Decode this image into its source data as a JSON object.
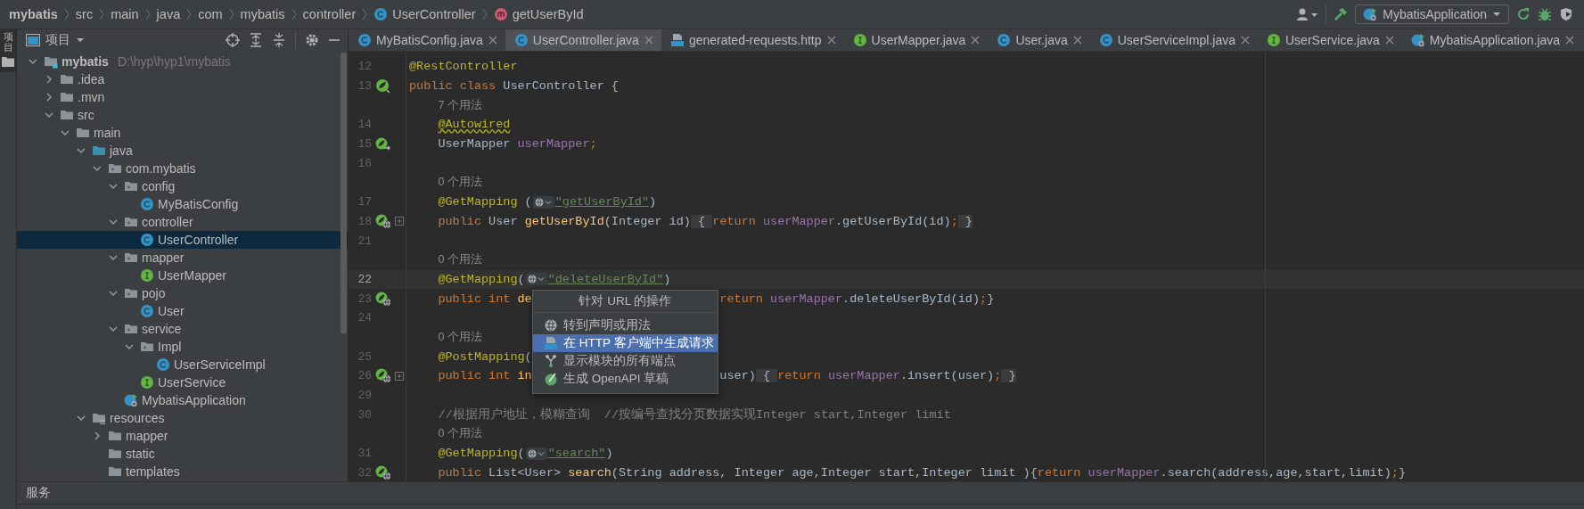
{
  "breadcrumb": [
    {
      "kind": "project",
      "label": "mybatis"
    },
    {
      "kind": "folder",
      "label": "src"
    },
    {
      "kind": "folder",
      "label": "main"
    },
    {
      "kind": "folder",
      "label": "java"
    },
    {
      "kind": "folder",
      "label": "com"
    },
    {
      "kind": "folder",
      "label": "mybatis"
    },
    {
      "kind": "folder",
      "label": "controller"
    },
    {
      "kind": "class",
      "label": "UserController"
    },
    {
      "kind": "method",
      "label": "getUserById"
    }
  ],
  "toolbar": {
    "run_config": "MybatisApplication"
  },
  "side_strip": {
    "label": "项目",
    "selected": true
  },
  "project_panel": {
    "title": "项目",
    "tree": [
      {
        "label": "mybatis",
        "kind": "module",
        "path": "D:\\hyp\\hyp1\\mybatis",
        "expanded": true,
        "selected": false,
        "children": [
          {
            "label": ".idea",
            "kind": "folder",
            "expanded": false,
            "selected": false
          },
          {
            "label": ".mvn",
            "kind": "folder",
            "expanded": false,
            "selected": false
          },
          {
            "label": "src",
            "kind": "folder",
            "expanded": true,
            "selected": false,
            "children": [
              {
                "label": "main",
                "kind": "folder",
                "expanded": true,
                "selected": false,
                "children": [
                  {
                    "label": "java",
                    "kind": "source",
                    "expanded": true,
                    "selected": false,
                    "children": [
                      {
                        "label": "com.mybatis",
                        "kind": "package",
                        "expanded": true,
                        "selected": false,
                        "children": [
                          {
                            "label": "config",
                            "kind": "package",
                            "expanded": true,
                            "selected": false,
                            "children": [
                              {
                                "label": "MyBatisConfig",
                                "kind": "class",
                                "selected": false
                              }
                            ]
                          },
                          {
                            "label": "controller",
                            "kind": "package",
                            "expanded": true,
                            "selected": false,
                            "children": [
                              {
                                "label": "UserController",
                                "kind": "class",
                                "selected": true
                              }
                            ]
                          },
                          {
                            "label": "mapper",
                            "kind": "package",
                            "expanded": true,
                            "selected": false,
                            "children": [
                              {
                                "label": "UserMapper",
                                "kind": "interface",
                                "selected": false
                              }
                            ]
                          },
                          {
                            "label": "pojo",
                            "kind": "package",
                            "expanded": true,
                            "selected": false,
                            "children": [
                              {
                                "label": "User",
                                "kind": "class",
                                "selected": false
                              }
                            ]
                          },
                          {
                            "label": "service",
                            "kind": "package",
                            "expanded": true,
                            "selected": false,
                            "children": [
                              {
                                "label": "Impl",
                                "kind": "package",
                                "expanded": true,
                                "selected": false,
                                "children": [
                                  {
                                    "label": "UserServiceImpl",
                                    "kind": "class",
                                    "selected": false
                                  }
                                ]
                              },
                              {
                                "label": "UserService",
                                "kind": "interface",
                                "selected": false
                              }
                            ]
                          },
                          {
                            "label": "MybatisApplication",
                            "kind": "app",
                            "selected": false
                          }
                        ]
                      }
                    ]
                  },
                  {
                    "label": "resources",
                    "kind": "resources",
                    "expanded": true,
                    "selected": false,
                    "children": [
                      {
                        "label": "mapper",
                        "kind": "folder",
                        "expanded": false,
                        "selected": false
                      },
                      {
                        "label": "static",
                        "kind": "folder",
                        "selected": false
                      },
                      {
                        "label": "templates",
                        "kind": "folder",
                        "selected": false
                      }
                    ]
                  }
                ]
              }
            ]
          }
        ]
      }
    ]
  },
  "tabs": [
    {
      "label": "MyBatisConfig.java",
      "kind": "class",
      "selected": false
    },
    {
      "label": "UserController.java",
      "kind": "class",
      "selected": true
    },
    {
      "label": "generated-requests.http",
      "kind": "api",
      "selected": false
    },
    {
      "label": "UserMapper.java",
      "kind": "interface",
      "selected": false
    },
    {
      "label": "User.java",
      "kind": "class",
      "selected": false
    },
    {
      "label": "UserServiceImpl.java",
      "kind": "class",
      "selected": false
    },
    {
      "label": "UserService.java",
      "kind": "interface",
      "selected": false
    },
    {
      "label": "MybatisApplication.java",
      "kind": "app",
      "selected": false
    }
  ],
  "editor": {
    "rows": [
      {
        "kind": "code",
        "num": "12",
        "current": false,
        "tokens": [
          {
            "kind": "ann",
            "text": "@RestController"
          }
        ]
      },
      {
        "kind": "code",
        "num": "13",
        "current": false,
        "gutter": {
          "kind": "bean"
        },
        "tokens": [
          {
            "kind": "kw",
            "text": "public class "
          },
          {
            "kind": "plain",
            "text": "UserController {"
          }
        ]
      },
      {
        "kind": "hint",
        "text": "7 个用法"
      },
      {
        "kind": "code",
        "num": "14",
        "current": false,
        "indented": true,
        "tokens": [
          {
            "kind": "warn",
            "text": "@Autowired"
          }
        ]
      },
      {
        "kind": "code",
        "num": "15",
        "current": false,
        "indented": true,
        "gutter": {
          "kind": "injection"
        },
        "tokens": [
          {
            "kind": "plain",
            "text": "UserMapper "
          },
          {
            "kind": "field",
            "text": "userMapper"
          },
          {
            "kind": "kw",
            "text": ";"
          }
        ]
      },
      {
        "kind": "code",
        "num": "16",
        "current": false,
        "tokens": []
      },
      {
        "kind": "hint",
        "text": "0 个用法"
      },
      {
        "kind": "code",
        "num": "17",
        "current": false,
        "indented": true,
        "tokens": [
          {
            "kind": "ann",
            "text": "@GetMapping "
          },
          {
            "kind": "plain",
            "text": "("
          },
          {
            "kind": "inlay"
          },
          {
            "kind": "link",
            "text": "\"getUserById\""
          },
          {
            "kind": "plain",
            "text": ")"
          }
        ]
      },
      {
        "kind": "code",
        "num": "18",
        "current": false,
        "indented": true,
        "gutter": {
          "kind": "endpoint"
        },
        "fold": true,
        "tokens": [
          {
            "kind": "kw",
            "text": "public "
          },
          {
            "kind": "plain",
            "text": "User "
          },
          {
            "kind": "method",
            "text": "getUserById"
          },
          {
            "kind": "plain",
            "text": "(Integer id)"
          },
          {
            "kind": "fold",
            "text": " { "
          },
          {
            "kind": "kw",
            "text": "return "
          },
          {
            "kind": "field",
            "text": "userMapper"
          },
          {
            "kind": "plain",
            "text": ".getUserById(id)"
          },
          {
            "kind": "kw",
            "text": ";"
          },
          {
            "kind": "fold",
            "text": " }"
          }
        ]
      },
      {
        "kind": "code",
        "num": "21",
        "current": false,
        "tokens": []
      },
      {
        "kind": "hint",
        "text": "0 个用法"
      },
      {
        "kind": "code",
        "num": "22",
        "current": true,
        "indented": true,
        "tokens": [
          {
            "kind": "ann",
            "text": "@GetMapping"
          },
          {
            "kind": "plain",
            "text": "("
          },
          {
            "kind": "inlay"
          },
          {
            "kind": "link",
            "text": "\"deleteUserById\""
          },
          {
            "kind": "plain",
            "text": ")"
          }
        ]
      },
      {
        "kind": "code",
        "num": "23",
        "current": false,
        "indented": true,
        "gutter": {
          "kind": "endpoint"
        },
        "tokens": [
          {
            "kind": "kw",
            "text": "public int "
          },
          {
            "kind": "method",
            "text": "de"
          },
          {
            "kind": "covered"
          },
          {
            "kind": "kw",
            "text": "return "
          },
          {
            "kind": "field",
            "text": "userMapper"
          },
          {
            "kind": "plain",
            "text": ".deleteUserById(id)"
          },
          {
            "kind": "kw",
            "text": ";"
          },
          {
            "kind": "plain",
            "text": "}"
          }
        ]
      },
      {
        "kind": "code",
        "num": "24",
        "current": false,
        "tokens": []
      },
      {
        "kind": "hint",
        "text": "0 个用法"
      },
      {
        "kind": "code",
        "num": "25",
        "current": false,
        "indented": true,
        "tokens": [
          {
            "kind": "ann",
            "text": "@PostMapping"
          },
          {
            "kind": "plain",
            "text": "("
          }
        ]
      },
      {
        "kind": "code",
        "num": "26",
        "current": false,
        "indented": true,
        "gutter": {
          "kind": "endpoint"
        },
        "fold": true,
        "tokens": [
          {
            "kind": "kw",
            "text": "public int "
          },
          {
            "kind": "method",
            "text": "in"
          },
          {
            "kind": "covered"
          },
          {
            "kind": "plain",
            "text": "user)"
          },
          {
            "kind": "fold",
            "text": " { "
          },
          {
            "kind": "kw",
            "text": "return "
          },
          {
            "kind": "field",
            "text": "userMapper"
          },
          {
            "kind": "plain",
            "text": ".insert(user)"
          },
          {
            "kind": "kw",
            "text": ";"
          },
          {
            "kind": "fold",
            "text": " }"
          }
        ]
      },
      {
        "kind": "code",
        "num": "29",
        "current": false,
        "tokens": []
      },
      {
        "kind": "code",
        "num": "30",
        "current": false,
        "indented": true,
        "tokens": [
          {
            "kind": "comment",
            "text": "//根据用户地址，模糊查询  //按编号查找分页数据实现Integer start,Integer limit"
          }
        ]
      },
      {
        "kind": "hint",
        "text": "0 个用法"
      },
      {
        "kind": "code",
        "num": "31",
        "current": false,
        "indented": true,
        "tokens": [
          {
            "kind": "ann",
            "text": "@GetMapping"
          },
          {
            "kind": "plain",
            "text": "("
          },
          {
            "kind": "inlay"
          },
          {
            "kind": "link",
            "text": "\"search\""
          },
          {
            "kind": "plain",
            "text": ")"
          }
        ]
      },
      {
        "kind": "code",
        "num": "32",
        "current": false,
        "indented": true,
        "gutter": {
          "kind": "endpoint"
        },
        "tokens": [
          {
            "kind": "kw",
            "text": "public "
          },
          {
            "kind": "plain",
            "text": "List<User> "
          },
          {
            "kind": "method",
            "text": "search"
          },
          {
            "kind": "plain",
            "text": "(String address, Integer age,Integer start,Integer limit ){"
          },
          {
            "kind": "kw",
            "text": "return "
          },
          {
            "kind": "field",
            "text": "userMapper"
          },
          {
            "kind": "plain",
            "text": ".search(address,age,start,limit)"
          },
          {
            "kind": "kw",
            "text": ";"
          },
          {
            "kind": "plain",
            "text": "}"
          }
        ]
      }
    ]
  },
  "popup": {
    "title": "针对 URL 的操作",
    "items": [
      {
        "kind": "globe",
        "label": "转到声明或用法",
        "selected": false
      },
      {
        "kind": "api",
        "label": "在 HTTP 客户端中生成请求",
        "selected": true
      },
      {
        "kind": "endpoints",
        "label": "显示模块的所有端点",
        "selected": false
      },
      {
        "kind": "openapi",
        "label": "生成 OpenAPI 草稿",
        "selected": false
      }
    ]
  },
  "bottom_panel": {
    "title": "服务"
  }
}
